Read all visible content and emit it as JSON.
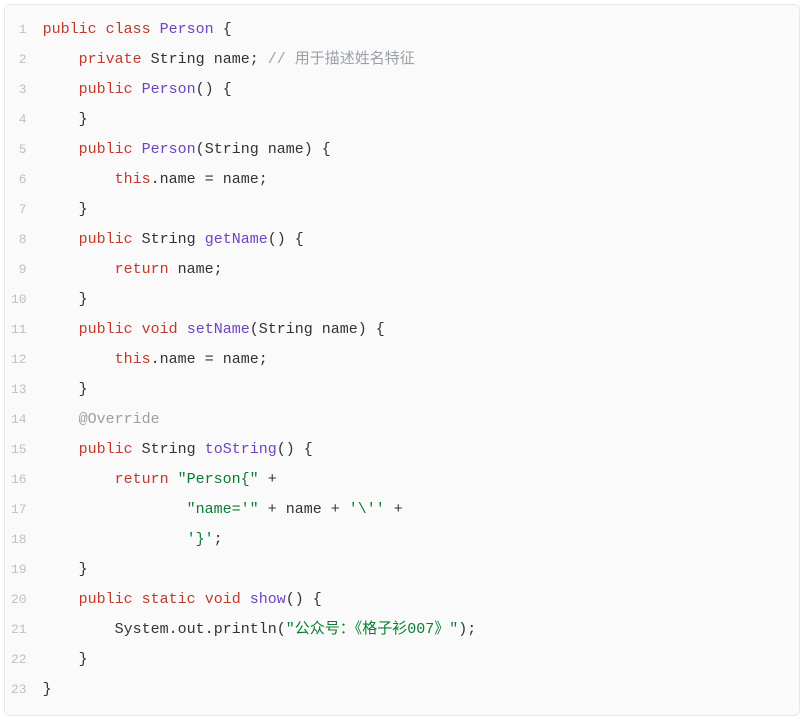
{
  "code": {
    "lineNumbers": [
      "1",
      "2",
      "3",
      "4",
      "5",
      "6",
      "7",
      "8",
      "9",
      "10",
      "11",
      "12",
      "13",
      "14",
      "15",
      "16",
      "17",
      "18",
      "19",
      "20",
      "21",
      "22",
      "23"
    ],
    "lines": [
      [
        {
          "t": "kw",
          "v": "public"
        },
        {
          "t": "sp",
          "v": " "
        },
        {
          "t": "kw",
          "v": "class"
        },
        {
          "t": "sp",
          "v": " "
        },
        {
          "t": "cls",
          "v": "Person"
        },
        {
          "t": "sp",
          "v": " "
        },
        {
          "t": "punc",
          "v": "{"
        }
      ],
      [
        {
          "t": "sp",
          "v": "    "
        },
        {
          "t": "kw",
          "v": "private"
        },
        {
          "t": "sp",
          "v": " "
        },
        {
          "t": "type",
          "v": "String"
        },
        {
          "t": "sp",
          "v": " "
        },
        {
          "t": "ident",
          "v": "name"
        },
        {
          "t": "punc",
          "v": ";"
        },
        {
          "t": "sp",
          "v": " "
        },
        {
          "t": "cmt",
          "v": "// 用于描述姓名特征"
        }
      ],
      [
        {
          "t": "sp",
          "v": "    "
        },
        {
          "t": "kw",
          "v": "public"
        },
        {
          "t": "sp",
          "v": " "
        },
        {
          "t": "cls",
          "v": "Person"
        },
        {
          "t": "punc",
          "v": "()"
        },
        {
          "t": "sp",
          "v": " "
        },
        {
          "t": "punc",
          "v": "{"
        }
      ],
      [
        {
          "t": "sp",
          "v": "    "
        },
        {
          "t": "punc",
          "v": "}"
        }
      ],
      [
        {
          "t": "sp",
          "v": "    "
        },
        {
          "t": "kw",
          "v": "public"
        },
        {
          "t": "sp",
          "v": " "
        },
        {
          "t": "cls",
          "v": "Person"
        },
        {
          "t": "punc",
          "v": "("
        },
        {
          "t": "type",
          "v": "String"
        },
        {
          "t": "sp",
          "v": " "
        },
        {
          "t": "ident",
          "v": "name"
        },
        {
          "t": "punc",
          "v": ")"
        },
        {
          "t": "sp",
          "v": " "
        },
        {
          "t": "punc",
          "v": "{"
        }
      ],
      [
        {
          "t": "sp",
          "v": "        "
        },
        {
          "t": "kw",
          "v": "this"
        },
        {
          "t": "punc",
          "v": "."
        },
        {
          "t": "ident",
          "v": "name"
        },
        {
          "t": "sp",
          "v": " "
        },
        {
          "t": "punc",
          "v": "="
        },
        {
          "t": "sp",
          "v": " "
        },
        {
          "t": "ident",
          "v": "name"
        },
        {
          "t": "punc",
          "v": ";"
        }
      ],
      [
        {
          "t": "sp",
          "v": "    "
        },
        {
          "t": "punc",
          "v": "}"
        }
      ],
      [
        {
          "t": "sp",
          "v": "    "
        },
        {
          "t": "kw",
          "v": "public"
        },
        {
          "t": "sp",
          "v": " "
        },
        {
          "t": "type",
          "v": "String"
        },
        {
          "t": "sp",
          "v": " "
        },
        {
          "t": "fn",
          "v": "getName"
        },
        {
          "t": "punc",
          "v": "()"
        },
        {
          "t": "sp",
          "v": " "
        },
        {
          "t": "punc",
          "v": "{"
        }
      ],
      [
        {
          "t": "sp",
          "v": "        "
        },
        {
          "t": "kw",
          "v": "return"
        },
        {
          "t": "sp",
          "v": " "
        },
        {
          "t": "ident",
          "v": "name"
        },
        {
          "t": "punc",
          "v": ";"
        }
      ],
      [
        {
          "t": "sp",
          "v": "    "
        },
        {
          "t": "punc",
          "v": "}"
        }
      ],
      [
        {
          "t": "sp",
          "v": "    "
        },
        {
          "t": "kw",
          "v": "public"
        },
        {
          "t": "sp",
          "v": " "
        },
        {
          "t": "kw",
          "v": "void"
        },
        {
          "t": "sp",
          "v": " "
        },
        {
          "t": "fn",
          "v": "setName"
        },
        {
          "t": "punc",
          "v": "("
        },
        {
          "t": "type",
          "v": "String"
        },
        {
          "t": "sp",
          "v": " "
        },
        {
          "t": "ident",
          "v": "name"
        },
        {
          "t": "punc",
          "v": ")"
        },
        {
          "t": "sp",
          "v": " "
        },
        {
          "t": "punc",
          "v": "{"
        }
      ],
      [
        {
          "t": "sp",
          "v": "        "
        },
        {
          "t": "kw",
          "v": "this"
        },
        {
          "t": "punc",
          "v": "."
        },
        {
          "t": "ident",
          "v": "name"
        },
        {
          "t": "sp",
          "v": " "
        },
        {
          "t": "punc",
          "v": "="
        },
        {
          "t": "sp",
          "v": " "
        },
        {
          "t": "ident",
          "v": "name"
        },
        {
          "t": "punc",
          "v": ";"
        }
      ],
      [
        {
          "t": "sp",
          "v": "    "
        },
        {
          "t": "punc",
          "v": "}"
        }
      ],
      [
        {
          "t": "sp",
          "v": "    "
        },
        {
          "t": "ann",
          "v": "@Override"
        }
      ],
      [
        {
          "t": "sp",
          "v": "    "
        },
        {
          "t": "kw",
          "v": "public"
        },
        {
          "t": "sp",
          "v": " "
        },
        {
          "t": "type",
          "v": "String"
        },
        {
          "t": "sp",
          "v": " "
        },
        {
          "t": "fn",
          "v": "toString"
        },
        {
          "t": "punc",
          "v": "()"
        },
        {
          "t": "sp",
          "v": " "
        },
        {
          "t": "punc",
          "v": "{"
        }
      ],
      [
        {
          "t": "sp",
          "v": "        "
        },
        {
          "t": "kw",
          "v": "return"
        },
        {
          "t": "sp",
          "v": " "
        },
        {
          "t": "str",
          "v": "\"Person{\""
        },
        {
          "t": "sp",
          "v": " "
        },
        {
          "t": "punc",
          "v": "+"
        }
      ],
      [
        {
          "t": "sp",
          "v": "                "
        },
        {
          "t": "str",
          "v": "\"name='\""
        },
        {
          "t": "sp",
          "v": " "
        },
        {
          "t": "punc",
          "v": "+"
        },
        {
          "t": "sp",
          "v": " "
        },
        {
          "t": "ident",
          "v": "name"
        },
        {
          "t": "sp",
          "v": " "
        },
        {
          "t": "punc",
          "v": "+"
        },
        {
          "t": "sp",
          "v": " "
        },
        {
          "t": "str",
          "v": "'\\''"
        },
        {
          "t": "sp",
          "v": " "
        },
        {
          "t": "punc",
          "v": "+"
        }
      ],
      [
        {
          "t": "sp",
          "v": "                "
        },
        {
          "t": "str",
          "v": "'}'"
        },
        {
          "t": "punc",
          "v": ";"
        }
      ],
      [
        {
          "t": "sp",
          "v": "    "
        },
        {
          "t": "punc",
          "v": "}"
        }
      ],
      [
        {
          "t": "sp",
          "v": "    "
        },
        {
          "t": "kw",
          "v": "public"
        },
        {
          "t": "sp",
          "v": " "
        },
        {
          "t": "kw",
          "v": "static"
        },
        {
          "t": "sp",
          "v": " "
        },
        {
          "t": "kw",
          "v": "void"
        },
        {
          "t": "sp",
          "v": " "
        },
        {
          "t": "fn",
          "v": "show"
        },
        {
          "t": "punc",
          "v": "()"
        },
        {
          "t": "sp",
          "v": " "
        },
        {
          "t": "punc",
          "v": "{"
        }
      ],
      [
        {
          "t": "sp",
          "v": "        "
        },
        {
          "t": "ident",
          "v": "System"
        },
        {
          "t": "punc",
          "v": "."
        },
        {
          "t": "ident",
          "v": "out"
        },
        {
          "t": "punc",
          "v": "."
        },
        {
          "t": "ident",
          "v": "println"
        },
        {
          "t": "punc",
          "v": "("
        },
        {
          "t": "str",
          "v": "\"公众号：《格子衫007》\""
        },
        {
          "t": "punc",
          "v": ")"
        },
        {
          "t": "punc",
          "v": ";"
        }
      ],
      [
        {
          "t": "sp",
          "v": "    "
        },
        {
          "t": "punc",
          "v": "}"
        }
      ],
      [
        {
          "t": "punc",
          "v": "}"
        }
      ]
    ]
  }
}
